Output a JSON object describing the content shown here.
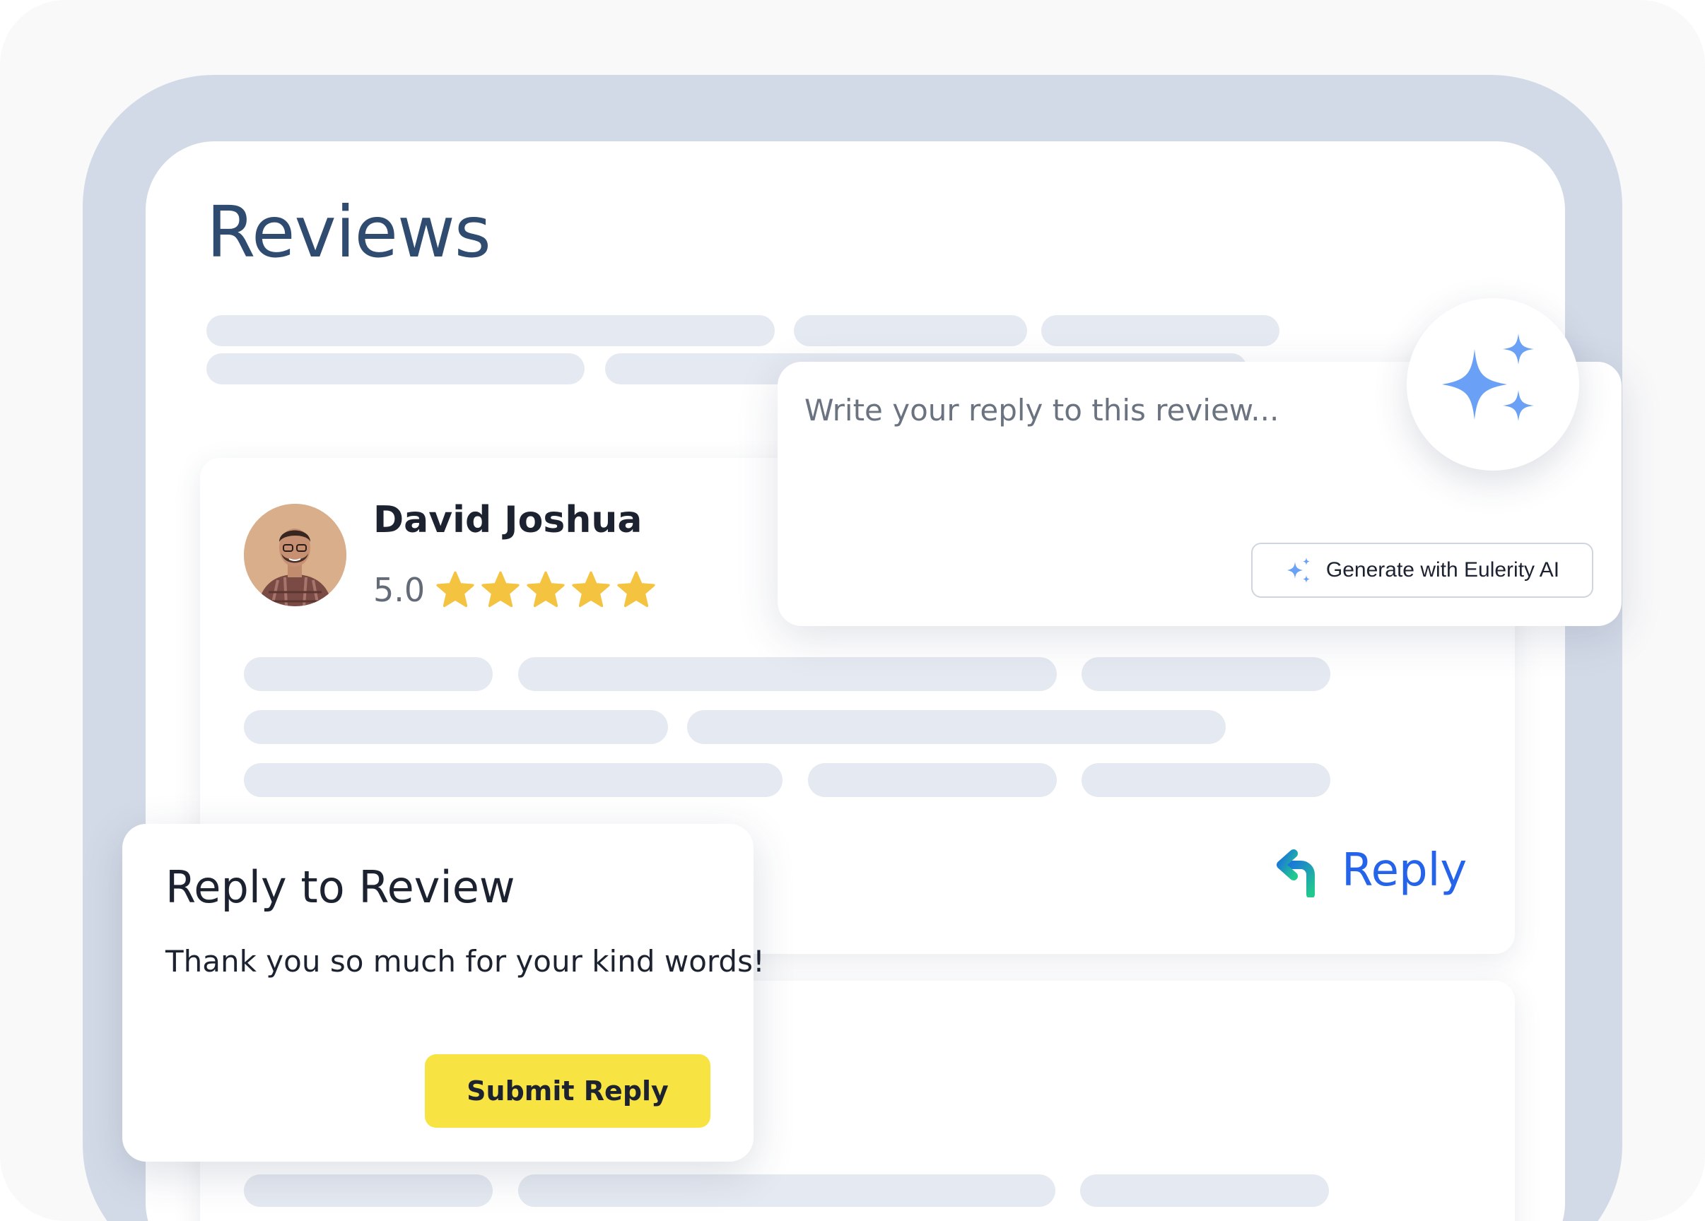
{
  "page": {
    "title": "Reviews"
  },
  "review": {
    "reviewer_name": "David Joshua",
    "rating_value": "5.0",
    "rating_stars": 5,
    "reply_label": "Reply",
    "reply_icon": "reply-arrow-icon"
  },
  "reply_composer": {
    "placeholder": "Write your reply to this review...",
    "generate_label": "Generate with Eulerity AI",
    "generate_icon": "sparkle-icon"
  },
  "reply_panel": {
    "title": "Reply to Review",
    "text": "Thank you so much for your kind words!",
    "submit_label": "Submit Reply"
  },
  "colors": {
    "title": "#2f4b6f",
    "star": "#f4c33f",
    "reply_link": "#2563eb",
    "sparkle": "#6aa0f5",
    "submit_button": "#f7e443",
    "frame": "#d3dae7",
    "skeleton": "#e5e9f1"
  }
}
